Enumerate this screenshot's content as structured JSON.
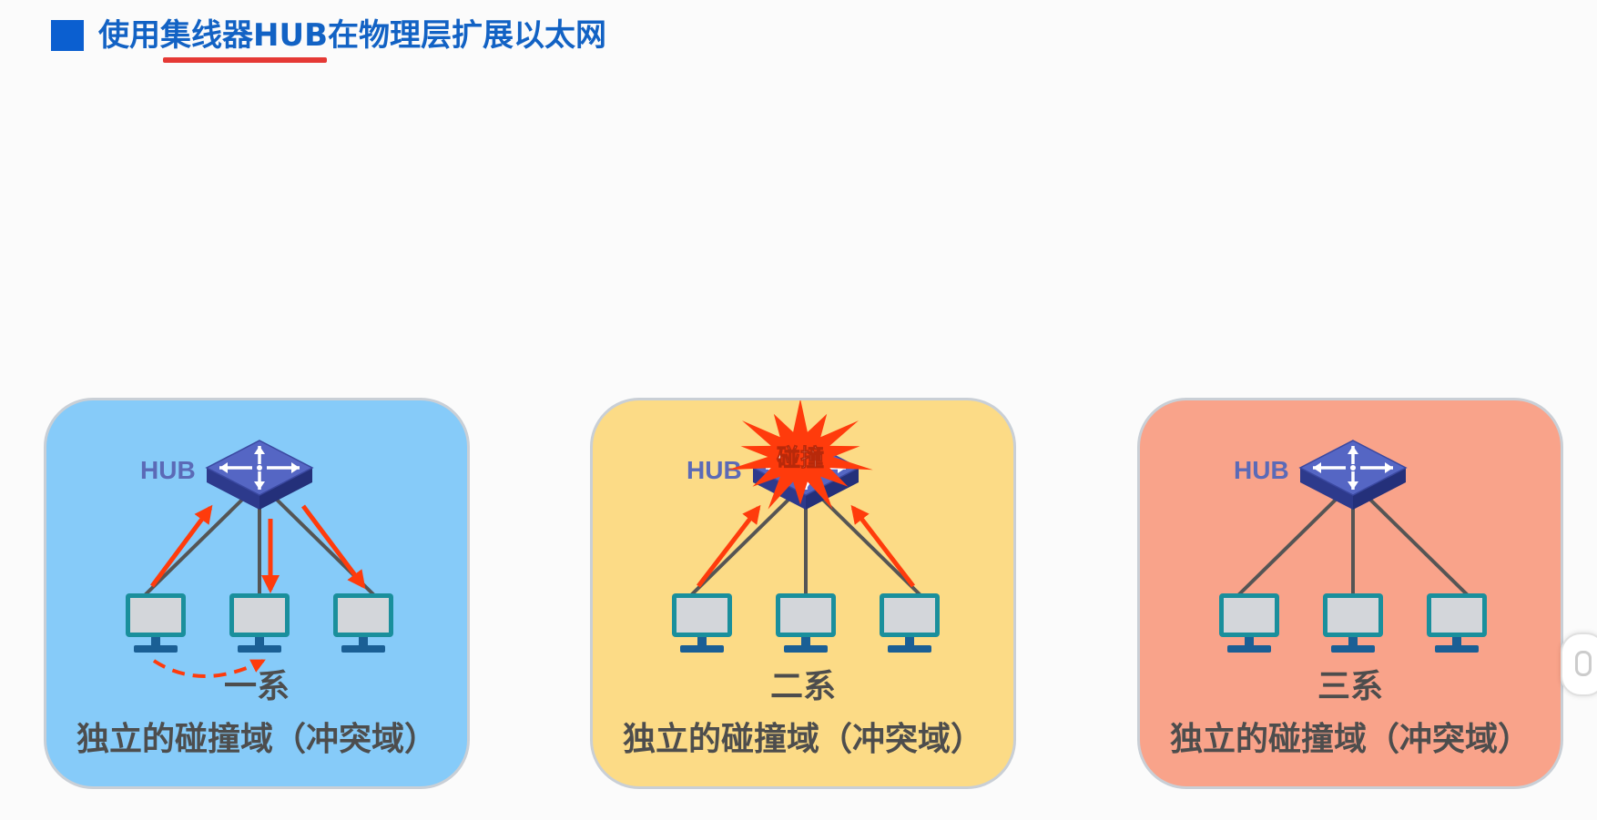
{
  "title": {
    "text": "使用集线器HUB在物理层扩展以太网",
    "color": "#1262c4",
    "marker_color": "#0b5fd0",
    "underline_color": "#e53935"
  },
  "panels": [
    {
      "id": "panel-1",
      "background": "#86cbf9",
      "hub_label": "HUB",
      "system_label": "一系",
      "caption": "独立的碰撞域（冲突域）",
      "collision": false,
      "shows_transmission_arrows": true
    },
    {
      "id": "panel-2",
      "background": "#fcdb86",
      "hub_label": "HUB",
      "system_label": "二系",
      "caption": "独立的碰撞域（冲突域）",
      "collision": true,
      "collision_label": "碰撞",
      "shows_transmission_arrows": true
    },
    {
      "id": "panel-3",
      "background": "#f9a38a",
      "hub_label": "HUB",
      "system_label": "三系",
      "caption": "独立的碰撞域（冲突域）",
      "collision": false,
      "shows_transmission_arrows": false
    }
  ],
  "colors": {
    "hub_fill": "#3c4ca8",
    "hub_top": "#5566c4",
    "hub_label": "#5b6ab7",
    "monitor_frame": "#1a8f9c",
    "monitor_screen": "#d3d6da",
    "monitor_base": "#1a5f95",
    "link_line": "#555555",
    "arrow_color": "#ff3b0c",
    "burst_fill": "#ff3b0c",
    "text_dark": "#4d4d4d"
  },
  "icons": [
    "hub-icon",
    "monitor-icon",
    "arrow-icon",
    "collision-burst-icon"
  ]
}
